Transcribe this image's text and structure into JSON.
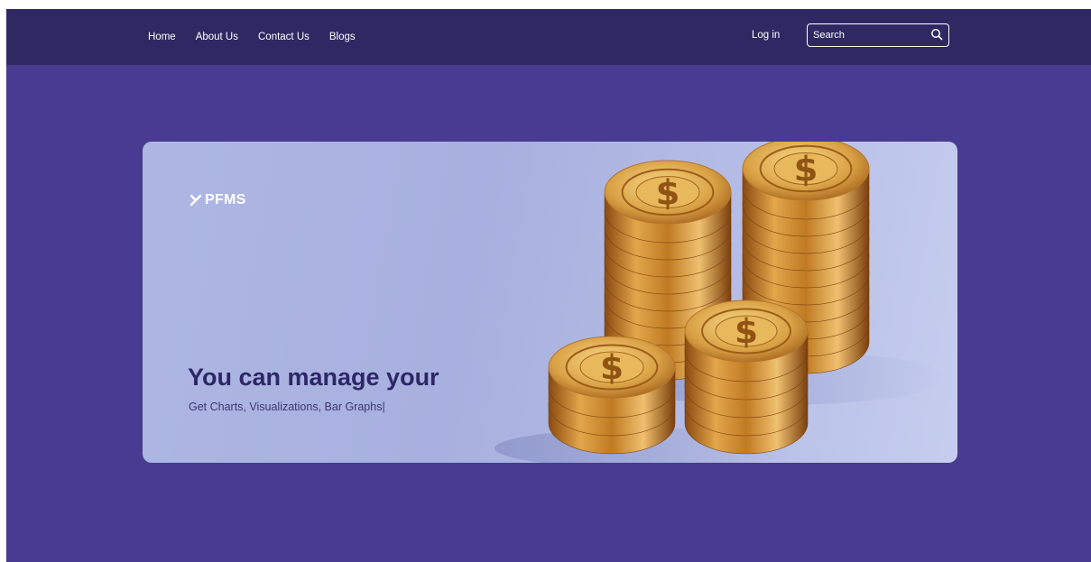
{
  "nav": {
    "links": [
      "Home",
      "About Us",
      "Contact Us",
      "Blogs"
    ],
    "login_label": "Log in",
    "search_placeholder": "Search"
  },
  "hero": {
    "brand": "PFMS",
    "headline": "You can manage your",
    "subline": "Get Charts, Visualizations, Bar Graphs|"
  },
  "colors": {
    "page_background": "#483b91",
    "navbar_background": "#302862",
    "headline_text": "#2d2668",
    "coin_gold": "#d39a3a"
  }
}
